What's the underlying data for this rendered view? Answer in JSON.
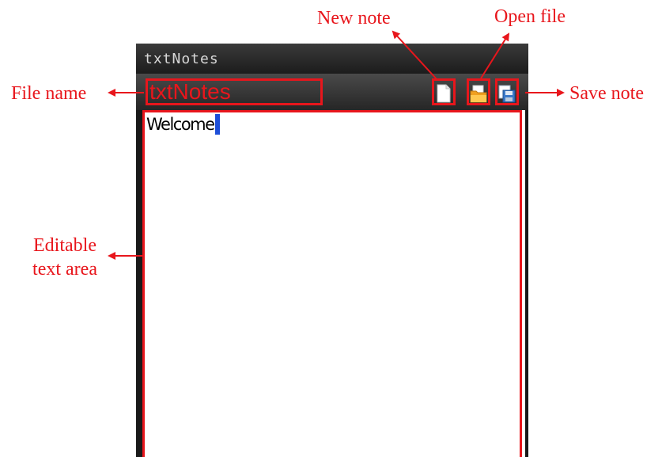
{
  "window": {
    "title": "txtNotes"
  },
  "toolbar": {
    "filename_value": "txtNotes",
    "new_icon": "new-note-icon",
    "open_icon": "open-folder-icon",
    "save_icon": "save-disk-icon"
  },
  "editor": {
    "content": "Welcome"
  },
  "annotations": {
    "file_name": "File name",
    "new_note": "New note",
    "open_file": "Open file",
    "save_note": "Save note",
    "editable_text_area": "Editable text area"
  },
  "colors": {
    "annotation": "#e8161c",
    "cursor": "#1e4fd8",
    "titlebar": "#2a2a2a"
  }
}
